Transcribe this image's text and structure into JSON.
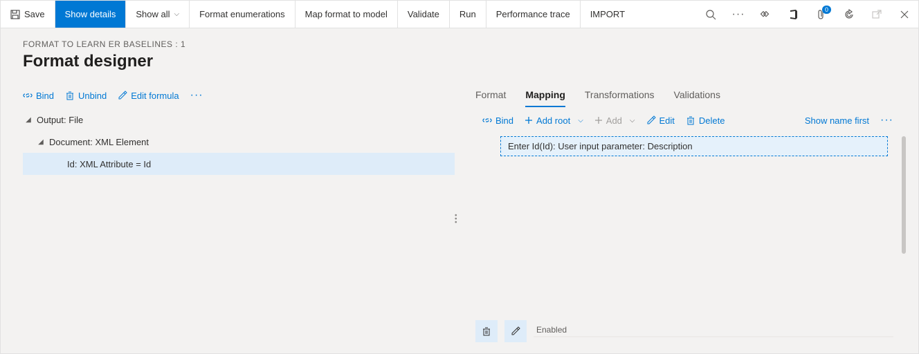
{
  "toolbar": {
    "save": "Save",
    "show_details": "Show details",
    "show_all": "Show all",
    "format_enum": "Format enumerations",
    "map_format": "Map format to model",
    "validate": "Validate",
    "run": "Run",
    "perf_trace": "Performance trace",
    "import": "IMPORT",
    "badge_count": "0"
  },
  "header": {
    "breadcrumb": "FORMAT TO LEARN ER BASELINES : 1",
    "title": "Format designer"
  },
  "left": {
    "actions": {
      "bind": "Bind",
      "unbind": "Unbind",
      "edit_formula": "Edit formula"
    },
    "tree": {
      "node0": "Output: File",
      "node1": "Document: XML Element",
      "node2": "Id: XML Attribute = Id"
    }
  },
  "right": {
    "tabs": {
      "format": "Format",
      "mapping": "Mapping",
      "transformations": "Transformations",
      "validations": "Validations"
    },
    "actions": {
      "bind": "Bind",
      "add_root": "Add root",
      "add": "Add",
      "edit": "Edit",
      "delete": "Delete",
      "show_name_first": "Show name first"
    },
    "mapping_item": "Enter Id(Id): User input parameter: Description",
    "enabled_label": "Enabled"
  }
}
